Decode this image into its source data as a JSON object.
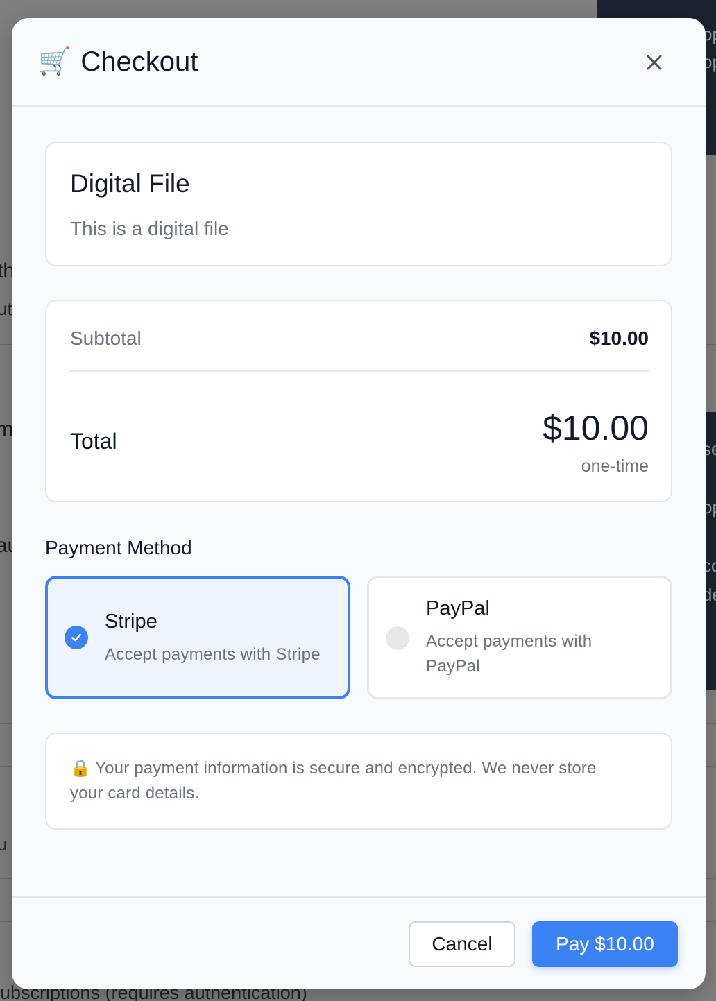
{
  "background": {
    "fragments": [
      "th",
      "utl",
      "m",
      "au",
      "u",
      "op",
      "op",
      "se",
      "op",
      "co",
      "de"
    ],
    "bottom_text": "ubscriptions (requires authentication)"
  },
  "modal": {
    "title": "Checkout",
    "title_icon": "🛒",
    "close_icon": "close-icon"
  },
  "product": {
    "name": "Digital File",
    "description": "This is a digital file"
  },
  "summary": {
    "subtotal_label": "Subtotal",
    "subtotal_value": "$10.00",
    "total_label": "Total",
    "total_value": "$10.00",
    "total_note": "one-time"
  },
  "payment": {
    "section_title": "Payment Method",
    "selected": "Stripe",
    "options": [
      {
        "name": "Stripe",
        "description": "Accept payments with Stripe"
      },
      {
        "name": "PayPal",
        "description": "Accept payments with PayPal"
      }
    ],
    "accent_color": "#3b82f6"
  },
  "security": {
    "icon": "🔒",
    "message": "Your payment information is secure and encrypted. We never store your card details."
  },
  "footer": {
    "cancel_label": "Cancel",
    "pay_label": "Pay $10.00"
  }
}
